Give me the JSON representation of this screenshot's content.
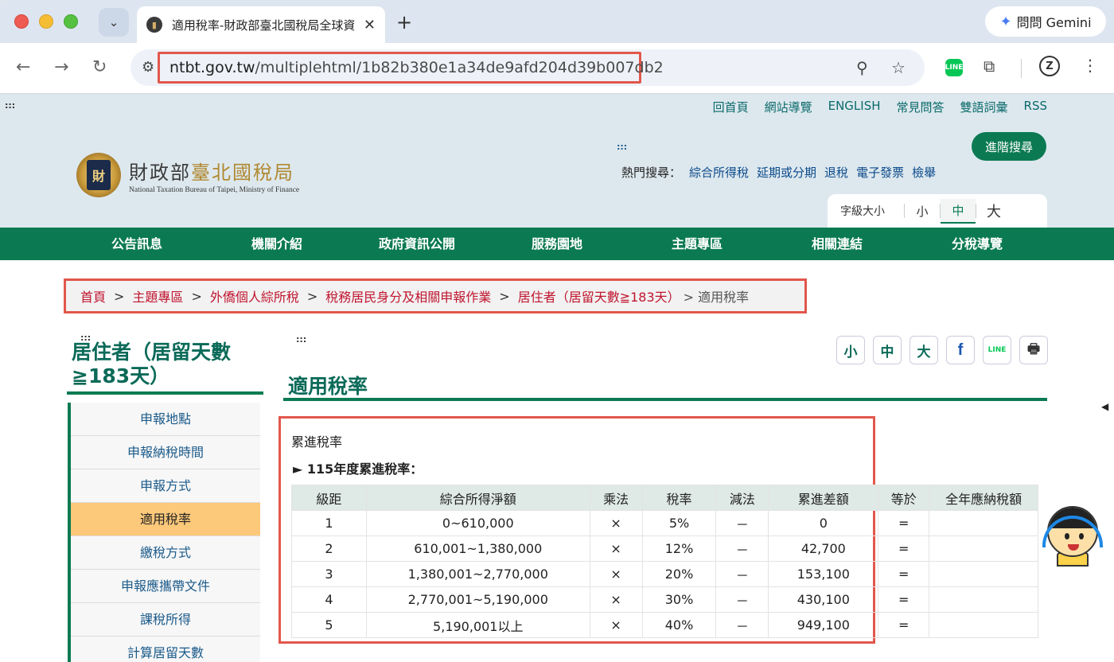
{
  "browser": {
    "tab_title": "適用稅率-財政部臺北國稅局全球資訊網",
    "new_tab": "+",
    "gemini_label": "問問 Gemini",
    "url_domain": "ntbt.gov.tw",
    "url_path": "/multiplehtml/1b82b380e1a34de9afd204d39b007db2"
  },
  "header": {
    "top_links": [
      "回首頁",
      "網站導覽",
      "ENGLISH",
      "常見問答",
      "雙語詞彙",
      "RSS"
    ],
    "logo_cn_1": "財政部",
    "logo_cn_2": "臺北國稅局",
    "logo_en": "National Taxation Bureau of Taipei, Ministry of Finance",
    "advanced_search": "進階搜尋",
    "hot_label": "熱門搜尋：",
    "hot_items": [
      "綜合所得稅",
      "延期或分期",
      "退稅",
      "電子發票",
      "檢舉"
    ],
    "font_size_label": "字級大小",
    "font_sizes": [
      "小",
      "中",
      "大"
    ],
    "acc_key": ":::"
  },
  "main_nav": [
    "公告訊息",
    "機關介紹",
    "政府資訊公開",
    "服務園地",
    "主題專區",
    "相關連結",
    "分稅導覽"
  ],
  "breadcrumb": {
    "links": [
      "首頁",
      "主題專區",
      "外僑個人綜所稅",
      "稅務居民身分及相關申報作業",
      "居住者（居留天數≧183天）"
    ],
    "sep": ">",
    "current": "適用稅率"
  },
  "sidebar": {
    "title": "居住者（居留天數≧183天）",
    "items": [
      "申報地點",
      "申報納稅時間",
      "申報方式",
      "適用稅率",
      "繳稅方式",
      "申報應攜帶文件",
      "課稅所得",
      "計算居留天數"
    ],
    "active_index": 3
  },
  "share": {
    "size_small": "小",
    "size_mid": "中",
    "size_large": "大",
    "facebook": "f",
    "line": "LINE",
    "print": "🖶"
  },
  "content": {
    "title": "適用稅率",
    "section_title": "累進稅率",
    "sub_title": "► 115年度累進稅率：",
    "table": {
      "headers": [
        "級距",
        "綜合所得淨額",
        "乘法",
        "稅率",
        "減法",
        "累進差額",
        "等於",
        "全年應納稅額"
      ],
      "rows": [
        [
          "1",
          "0~610,000",
          "×",
          "5%",
          "－",
          "0",
          "=",
          ""
        ],
        [
          "2",
          "610,001~1,380,000",
          "×",
          "12%",
          "－",
          "42,700",
          "=",
          ""
        ],
        [
          "3",
          "1,380,001~2,770,000",
          "×",
          "20%",
          "－",
          "153,100",
          "=",
          ""
        ],
        [
          "4",
          "2,770,001~5,190,000",
          "×",
          "30%",
          "－",
          "430,100",
          "=",
          ""
        ],
        [
          "5",
          "5,190,001以上",
          "×",
          "40%",
          "－",
          "949,100",
          "=",
          ""
        ]
      ]
    }
  },
  "colors": {
    "brand_green": "#0b7a52",
    "breadcrumb_link": "#c0152f",
    "highlight_box": "#e2574c",
    "active_menu": "#fcc87a"
  }
}
